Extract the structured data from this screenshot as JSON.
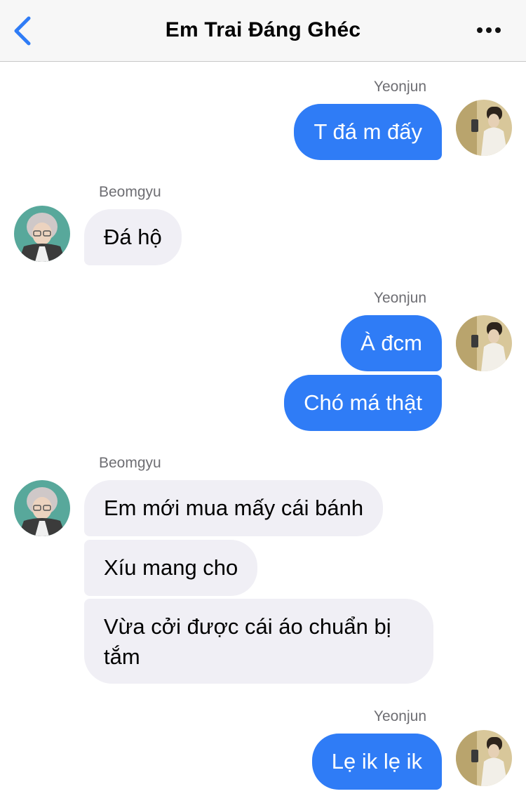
{
  "header": {
    "title": "Em Trai Đáng Ghéc"
  },
  "icons": {
    "back": "chevron-left-icon",
    "more": "ellipsis-icon"
  },
  "colors": {
    "outgoing_bubble": "#2f7cf6",
    "incoming_bubble": "#f0eff5",
    "accent": "#2f7cf6"
  },
  "senders": {
    "yeonjun": "Yeonjun",
    "beomgyu": "Beomgyu"
  },
  "messages": [
    {
      "sender": "Yeonjun",
      "text": "T đá m đấy"
    },
    {
      "sender": "Beomgyu",
      "text": "Đá hộ"
    },
    {
      "sender": "Yeonjun",
      "text": "À đcm"
    },
    {
      "sender": "Yeonjun",
      "text": "Chó má thật"
    },
    {
      "sender": "Beomgyu",
      "text": "Em mới mua mấy cái bánh"
    },
    {
      "sender": "Beomgyu",
      "text": "Xíu mang cho"
    },
    {
      "sender": "Beomgyu",
      "text": "Vừa cởi được cái áo chuẩn bị tắm"
    },
    {
      "sender": "Yeonjun",
      "text": "Lẹ ik lẹ ik"
    }
  ]
}
